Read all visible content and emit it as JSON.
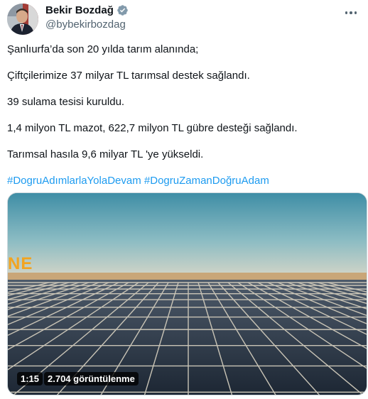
{
  "author": {
    "name": "Bekir Bozdağ",
    "handle": "@bybekirbozdag",
    "verified_color": "#829aab"
  },
  "tweet": {
    "paragraphs": [
      "Şanlıurfa’da son 20 yılda tarım alanında;",
      "Çiftçilerimize 37 milyar TL tarımsal destek sağlandı.",
      "39 sulama tesisi kuruldu.",
      "1,4 milyon TL mazot, 622,7 milyon TL gübre desteği sağlandı.",
      "Tarımsal hasıla 9,6 milyar TL 'ye yükseldi."
    ],
    "hashtags": [
      "#DogruAdımlarlaYolaDevam",
      "#DogruZamanDoğruAdam"
    ]
  },
  "video": {
    "overlay_text": "NE",
    "time": "1:15",
    "views": "2.704 görüntülenme"
  },
  "colors": {
    "link": "#1d9bf0",
    "text": "#0f1419",
    "secondary": "#536471",
    "overlay_text": "#f2a420"
  },
  "icons": {
    "verified": "verified-badge-icon",
    "more": "more-dots-icon"
  }
}
